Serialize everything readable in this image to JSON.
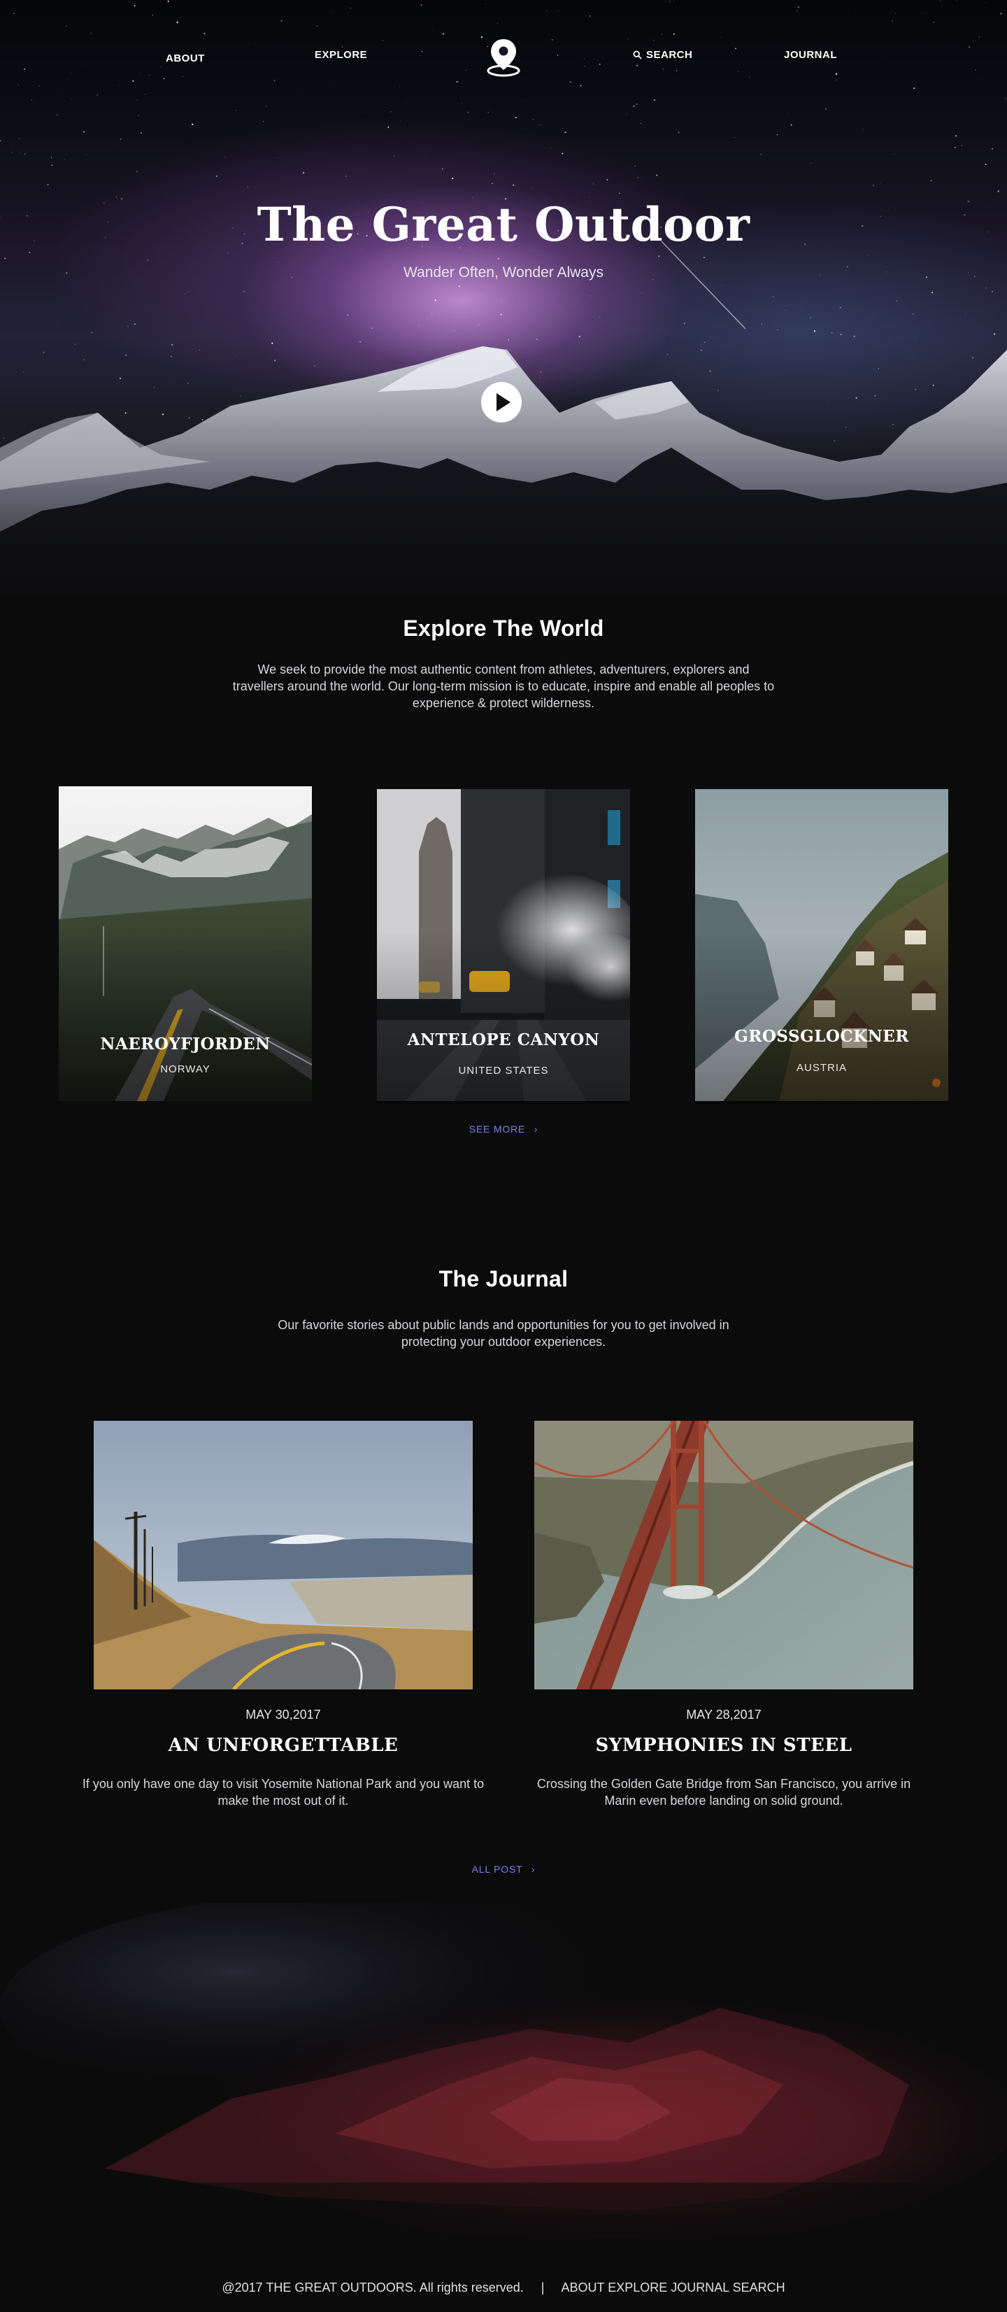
{
  "nav": {
    "about": "ABOUT",
    "explore": "EXPLORE",
    "search": "SEARCH",
    "journal": "JOURNAL",
    "logo_icon": "location-pin-icon",
    "search_icon": "search-icon"
  },
  "hero": {
    "title": "The Great Outdoor",
    "subtitle": "Wander Often, Wonder Always",
    "play_icon": "play-icon"
  },
  "explore": {
    "title": "Explore The World",
    "text": "We seek to provide the most authentic content from athletes, adventurers, explorers and travellers around the  world. Our long-term mission is to educate, inspire and enable all peoples to experience & protect wilderness.",
    "cards": [
      {
        "name": "NAEROYFJORDEN",
        "country": "NORWAY"
      },
      {
        "name": "ANTELOPE CANYON",
        "country": "UNITED STATES"
      },
      {
        "name": "GROSSGLOCKNER",
        "country": "AUSTRIA"
      }
    ],
    "see_more": "SEE MORE"
  },
  "journal": {
    "title": "The Journal",
    "text": "Our favorite stories about public lands and opportunities for you to get involved in protecting your outdoor experiences.",
    "posts": [
      {
        "date": "MAY 30,2017",
        "title": "AN UNFORGETTABLE",
        "text": "If you only have one day to visit Yosemite National Park and you want to make the most out of it."
      },
      {
        "date": "MAY 28,2017",
        "title": "SYMPHONIES IN STEEL",
        "text": "Crossing the Golden Gate Bridge from San Francisco, you arrive in Marin even before landing on solid ground."
      }
    ],
    "all_post": "ALL POST"
  },
  "footer": {
    "copyright": "@2017 THE GREAT OUTDOORS. All rights reserved.",
    "separator": "|",
    "links": [
      "ABOUT",
      "EXPLORE",
      "JOURNAL",
      "SEARCH"
    ]
  },
  "colors": {
    "background": "#0b0b0c",
    "accent_link": "#7f7ff0",
    "text": "#ffffff"
  }
}
